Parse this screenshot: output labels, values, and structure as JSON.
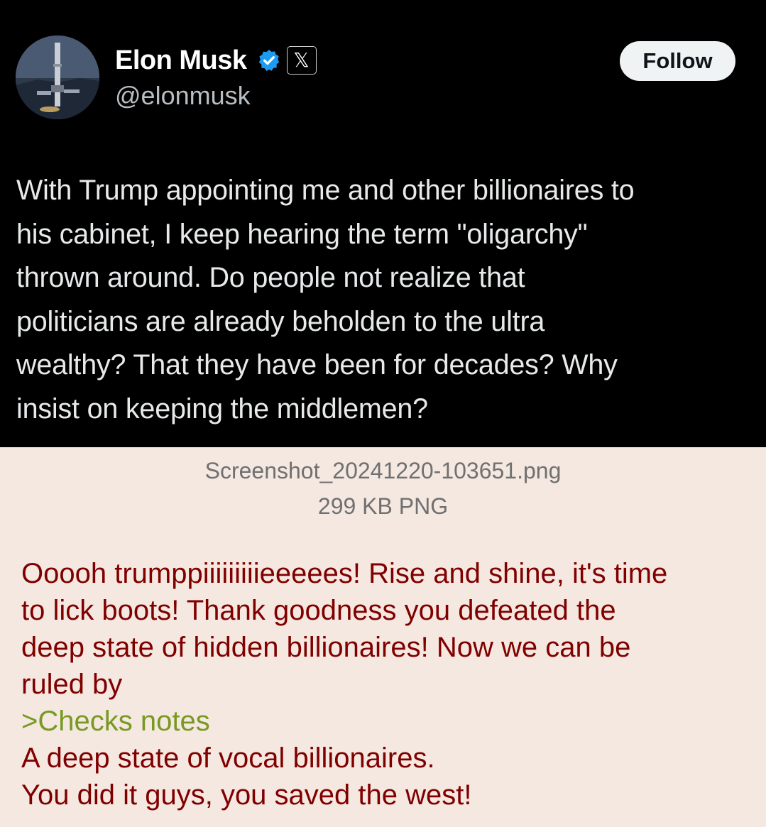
{
  "tweet": {
    "display_name": "Elon Musk",
    "handle": "@elonmusk",
    "verified_icon": "verified-badge-icon",
    "platform_icon": "x-logo-icon",
    "platform_glyph": "𝕏",
    "follow_label": "Follow",
    "text": "With Trump appointing me and other billionaires to\nhis cabinet, I keep hearing the term \"oligarchy\"\nthrown around. Do people not realize that\npoliticians are already beholden to the ultra\nwealthy? That they have been for decades? Why\ninsist on keeping the middlemen?",
    "colors": {
      "background": "#000000",
      "text": "#e7e9ea",
      "badge": "#1d9bf0"
    }
  },
  "attachment": {
    "file_name": "Screenshot_20241220-103651.png",
    "file_info": "299 KB PNG"
  },
  "post": {
    "lines": [
      "Ooooh trumppiiiiiiiiieeeees! Rise and shine, it's time",
      "to lick boots! Thank goodness you defeated the",
      "deep state of hidden billionaires! Now we can be",
      "ruled by"
    ],
    "greentext": ">Checks notes",
    "after_lines": [
      "A deep state of vocal billionaires.",
      "You did it guys, you saved the west!"
    ],
    "colors": {
      "text": "#800000",
      "greentext": "#789922",
      "background": "#f4e8e1"
    }
  }
}
